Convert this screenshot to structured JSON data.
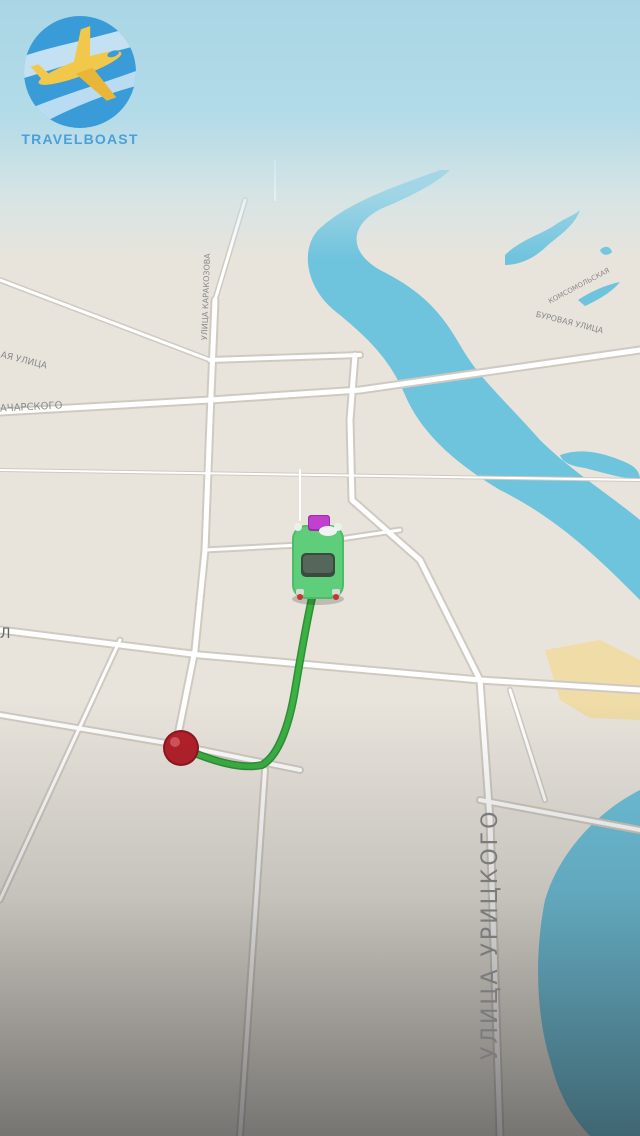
{
  "logo": {
    "brand_name": "TRAVELBOAST"
  },
  "map": {
    "street_labels": {
      "main_street": "УЛИЦА УРИЦКОГО",
      "left_street": "АЧАРСКОГО",
      "upper_vertical_street": "УЛИЦА КАРАКОЗОВА",
      "left_upper_street": "АЯ УЛИЦА",
      "right_street": "БУРОВАЯ УЛИЦА",
      "small_right_label": "КОМСОМОЛЬСКАЯ",
      "edge_label": "Л"
    },
    "colors": {
      "water": "#6ec3dd",
      "land": "#e8e4dc",
      "road": "#ffffff",
      "road_casing": "#cfcac1",
      "park": "#f0d99a",
      "route": "#3bb043",
      "destination_pin": "#b3202a",
      "car_body": "#5fce7a",
      "luggage": "#c23fd0"
    },
    "markers": {
      "car": "car-icon",
      "destination": "destination-pin-icon",
      "logo_plane": "airplane-icon"
    }
  }
}
